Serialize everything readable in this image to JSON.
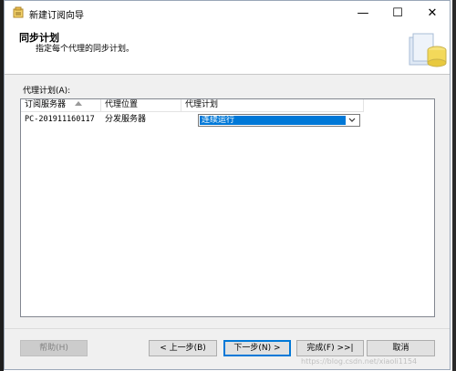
{
  "window": {
    "title": "新建订阅向导",
    "controls": {
      "minimize": "—",
      "maximize": "☐",
      "close": "✕"
    }
  },
  "header": {
    "title": "同步计划",
    "subtitle": "指定每个代理的同步计划。"
  },
  "group_label": "代理计划(A):",
  "table": {
    "columns": [
      "订阅服务器",
      "代理位置",
      "代理计划"
    ],
    "rows": [
      {
        "subscriber": "PC-201911160117",
        "location": "分发服务器",
        "schedule": "连续运行"
      }
    ]
  },
  "buttons": {
    "help": "帮助(H)",
    "back": "< 上一步(B)",
    "next": "下一步(N) >",
    "finish": "完成(F) >>|",
    "cancel": "取消"
  },
  "watermark": "https://blog.csdn.net/xiaoli1154",
  "colors": {
    "selection": "#0078d7",
    "accent": "#0078d7"
  }
}
